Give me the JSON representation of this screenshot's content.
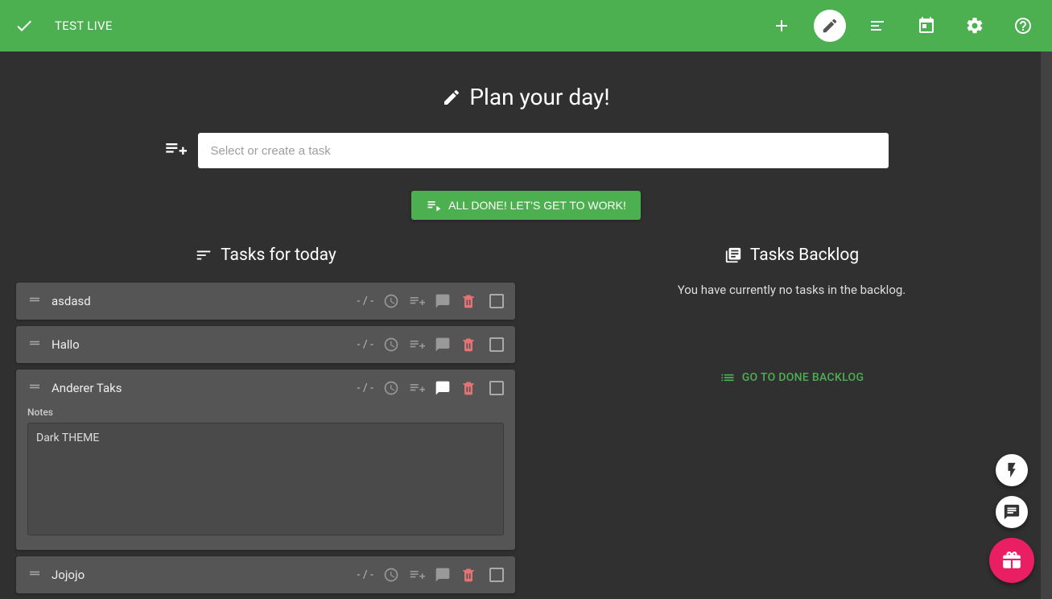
{
  "header": {
    "title": "TEST LIVE"
  },
  "main": {
    "page_title": "Plan your day!",
    "task_input_placeholder": "Select or create a task",
    "done_button": "ALL DONE! LET'S GET TO WORK!"
  },
  "today": {
    "section_title": "Tasks for today",
    "tasks": [
      {
        "title": "asdasd",
        "duration": "- / -",
        "notes_open": false
      },
      {
        "title": "Hallo",
        "duration": "- / -",
        "notes_open": false
      },
      {
        "title": "Anderer Taks",
        "duration": "- / -",
        "notes_open": true,
        "notes_label": "Notes",
        "notes_text": "Dark THEME"
      },
      {
        "title": "Jojojo",
        "duration": "- / -",
        "notes_open": false
      }
    ]
  },
  "backlog": {
    "section_title": "Tasks Backlog",
    "empty_text": "You have currently no tasks in the backlog.",
    "go_done_label": "GO TO DONE BACKLOG"
  },
  "colors": {
    "accent": "#4caf50",
    "danger": "#e57373",
    "fab_pink": "#e91e63"
  }
}
